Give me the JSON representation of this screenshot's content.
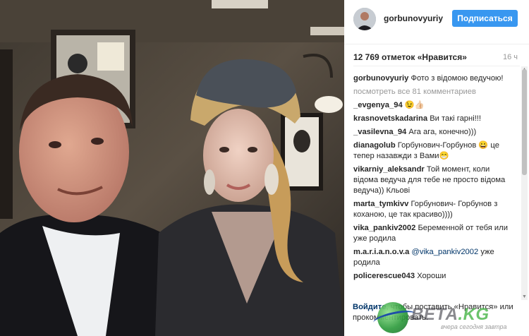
{
  "photo": {
    "description_icon": "selfie-photo"
  },
  "header": {
    "username": "gorbunovyuriy",
    "follow_label": "Подписаться"
  },
  "stats": {
    "likes": "12 769 отметок «Нравится»",
    "age": "16 ч"
  },
  "caption": {
    "user": "gorbunovyuriy",
    "text": "Фото з відомою ведучою!"
  },
  "view_all": "посмотреть все 81 комментариев",
  "comments": [
    {
      "user": "_evgenya_94",
      "text": "😉👍🏻"
    },
    {
      "user": "krasnovetskadarina",
      "text": "Ви такі гарні!!!"
    },
    {
      "user": "_vasilevna_94",
      "text": "Ага ага, конечно)))"
    },
    {
      "user": "dianagolub",
      "text": "Горбунович-Горбунов 😀 це тепер назавжди з Вами😁"
    },
    {
      "user": "vikarniy_aleksandr",
      "text": "Той момент, коли відома ведуча для тебе не просто відома ведуча)) Кльові"
    },
    {
      "user": "marta_tymkivv",
      "text": "Горбунович- Горбунов з коханою, це так красиво))))"
    },
    {
      "user": "vika_pankiv2002",
      "text": "Беременной от тебя или уже родила"
    },
    {
      "user": "m.a.r.i.a.n.o.v.a",
      "mention": "@vika_pankiv2002",
      "text": "уже родила"
    },
    {
      "user": "policerescue043",
      "text": "Хороши"
    }
  ],
  "login": {
    "link": "Войдите",
    "text": ", чтобы поставить «Нравится» или прокомментировать."
  },
  "watermark": {
    "brand": "ВЕТА",
    "tld": ".KG",
    "tagline": "вчера сегодня завтра"
  }
}
